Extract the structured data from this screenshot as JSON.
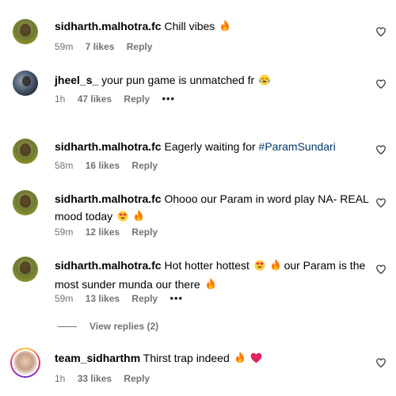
{
  "comments": [
    {
      "username": "sidharth.malhotra.fc",
      "text_before": "Chill vibes",
      "hashtag": "",
      "text_after": "",
      "emojis": [
        "fire"
      ],
      "time": "59m",
      "likes": "7 likes",
      "reply": "Reply",
      "has_more": false
    },
    {
      "username": "jheel_s_",
      "text_before": "your pun game is unmatched fr",
      "hashtag": "",
      "text_after": "",
      "emojis": [
        "crying-laughing"
      ],
      "time": "1h",
      "likes": "47 likes",
      "reply": "Reply",
      "has_more": true
    },
    {
      "username": "sidharth.malhotra.fc",
      "text_before": "Eagerly waiting for",
      "hashtag": "#ParamSundari",
      "text_after": "",
      "emojis": [],
      "time": "58m",
      "likes": "16 likes",
      "reply": "Reply",
      "has_more": false
    },
    {
      "username": "sidharth.malhotra.fc",
      "text_before": "Ohooo our Param in word play NA- REAL mood today",
      "hashtag": "",
      "text_after": "",
      "emojis": [
        "heart-eyes",
        "fire"
      ],
      "time": "59m",
      "likes": "12 likes",
      "reply": "Reply",
      "has_more": false
    },
    {
      "username": "sidharth.malhotra.fc",
      "text_before": "Hot hotter hottest",
      "hashtag": "",
      "text_after": "our Param is the most sunder munda our there",
      "emojis": [
        "heart-eyes",
        "fire"
      ],
      "emojis_after": [
        "fire"
      ],
      "time": "59m",
      "likes": "13 likes",
      "reply": "Reply",
      "has_more": true
    },
    {
      "username": "team_sidharthm",
      "text_before": "Thirst trap indeed",
      "hashtag": "",
      "text_after": "",
      "emojis": [
        "fire",
        "red-heart"
      ],
      "time": "1h",
      "likes": "33 likes",
      "reply": "Reply",
      "has_more": false
    }
  ],
  "view_replies": "View replies (2)",
  "more_label": "•••",
  "icons": {
    "like": "heart-outline-icon",
    "more": "more-options-icon"
  },
  "colors": {
    "hashtag": "#00376b",
    "meta": "#737373",
    "fire": "#ff7a00",
    "heart": "#e0245e"
  }
}
